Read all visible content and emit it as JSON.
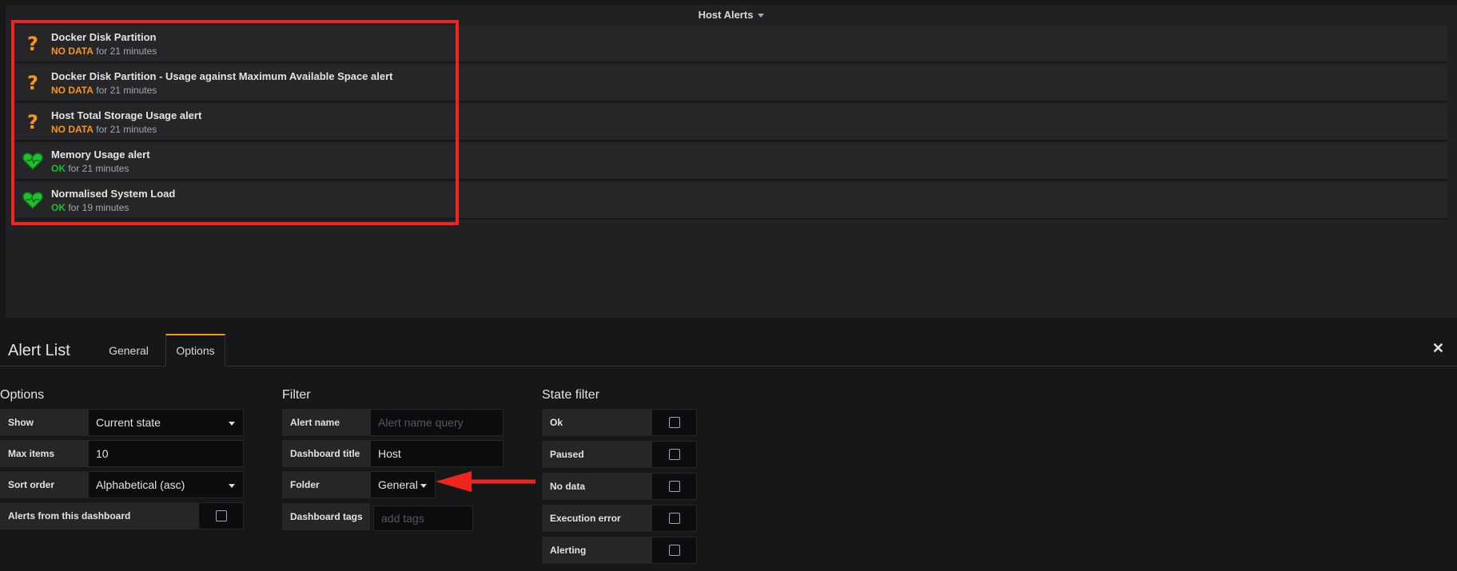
{
  "panel": {
    "title": "Host Alerts",
    "alerts": [
      {
        "name": "Docker Disk Partition",
        "state": "NO DATA",
        "duration": "for 21 minutes",
        "icon": "question-mark-icon"
      },
      {
        "name": "Docker Disk Partition - Usage against Maximum Available Space alert",
        "state": "NO DATA",
        "duration": "for 21 minutes",
        "icon": "question-mark-icon"
      },
      {
        "name": "Host Total Storage Usage alert",
        "state": "NO DATA",
        "duration": "for 21 minutes",
        "icon": "question-mark-icon"
      },
      {
        "name": "Memory Usage alert",
        "state": "OK",
        "duration": "for 21 minutes",
        "icon": "heart-icon"
      },
      {
        "name": "Normalised System Load",
        "state": "OK",
        "duration": "for 19 minutes",
        "icon": "heart-icon"
      }
    ]
  },
  "editor": {
    "title": "Alert List",
    "tabs": [
      {
        "label": "General"
      },
      {
        "label": "Options"
      }
    ],
    "active_tab": "Options",
    "options": {
      "heading": "Options",
      "show_label": "Show",
      "show_value": "Current state",
      "max_items_label": "Max items",
      "max_items_value": "10",
      "sort_order_label": "Sort order",
      "sort_order_value": "Alphabetical (asc)",
      "from_dashboard_label": "Alerts from this dashboard"
    },
    "filter": {
      "heading": "Filter",
      "alert_name_label": "Alert name",
      "alert_name_placeholder": "Alert name query",
      "dashboard_title_label": "Dashboard title",
      "dashboard_title_value": "Host",
      "folder_label": "Folder",
      "folder_value": "General",
      "dashboard_tags_label": "Dashboard tags",
      "dashboard_tags_placeholder": "add tags"
    },
    "state_filter": {
      "heading": "State filter",
      "items": [
        {
          "label": "Ok"
        },
        {
          "label": "Paused"
        },
        {
          "label": "No data"
        },
        {
          "label": "Execution error"
        },
        {
          "label": "Alerting"
        }
      ]
    }
  },
  "colors": {
    "no_data": "#f79520",
    "ok": "#1fbf2e",
    "annotation": "#f0251d"
  }
}
